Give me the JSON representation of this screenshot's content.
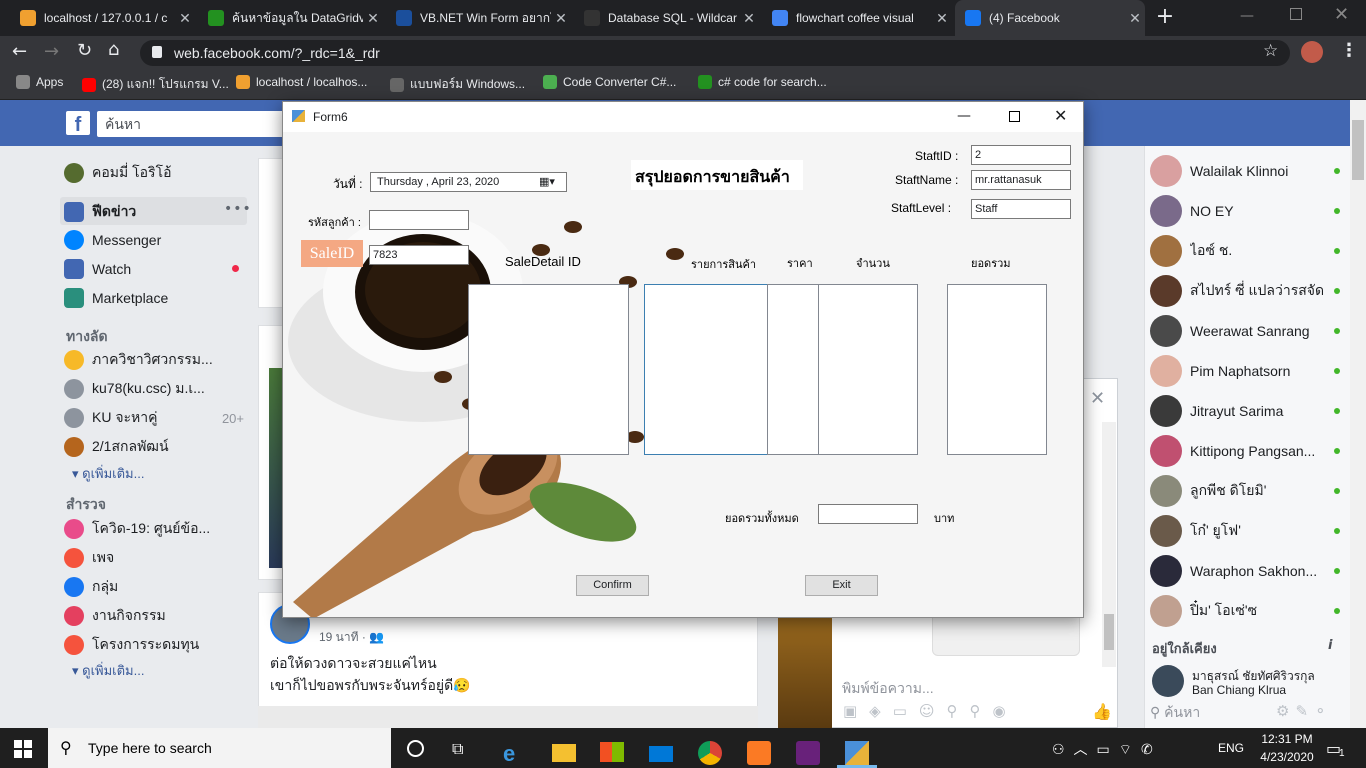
{
  "browser": {
    "tabs": [
      {
        "title": "localhost / 127.0.0.1 / c",
        "color": "#f0a030"
      },
      {
        "title": "ค้นหาข้อมูลใน DataGridvi",
        "color": "#239120"
      },
      {
        "title": "VB.NET Win Form อยากใ",
        "color": "#1b4f9c"
      },
      {
        "title": "Database SQL - Wildcar",
        "color": "#333333"
      },
      {
        "title": "flowchart coffee visual",
        "color": "#4285f4"
      },
      {
        "title": "(4) Facebook",
        "color": "#1877f2"
      }
    ],
    "url": "web.facebook.com/?_rdc=1&_rdr",
    "bookmarks": [
      {
        "label": "Apps",
        "color": "#888888"
      },
      {
        "label": "(28) แจก!! โปรแกรม V...",
        "color": "#ff0000"
      },
      {
        "label": "localhost / localhos...",
        "color": "#f0a030"
      },
      {
        "label": "แบบฟอร์ม Windows...",
        "color": "#666666"
      },
      {
        "label": "Code Converter C#...",
        "color": "#4caf50"
      },
      {
        "label": "c# code for search...",
        "color": "#239120"
      }
    ]
  },
  "facebook": {
    "search_placeholder": "ค้นหา",
    "profile_name": "คอมมี่ โอริโอ้",
    "nav": [
      {
        "label": "ฟีดข่าว",
        "color": "#4267b2"
      },
      {
        "label": "Messenger",
        "color": "#0084ff"
      },
      {
        "label": "Watch",
        "color": "#4267b2"
      },
      {
        "label": "Marketplace",
        "color": "#2a8f7d"
      }
    ],
    "shortcuts_title": "ทางลัด",
    "shortcuts": [
      {
        "label": "ภาควิชาวิศวกรรม...",
        "count": ""
      },
      {
        "label": "ku78(ku.csc) ม.เ...",
        "count": ""
      },
      {
        "label": "KU จะหาคู่",
        "count": "20+"
      },
      {
        "label": "2/1สกลพัฒน์",
        "count": ""
      }
    ],
    "see_more": "ดูเพิ่มเติม...",
    "explore_title": "สำรวจ",
    "explore": [
      {
        "label": "โควิด-19: ศูนย์ข้อ...",
        "color": "#e94b8a"
      },
      {
        "label": "เพจ",
        "color": "#f5533d"
      },
      {
        "label": "กลุ่ม",
        "color": "#1877f2"
      },
      {
        "label": "งานกิจกรรม",
        "color": "#e4405f"
      },
      {
        "label": "โครงการระดมทุน",
        "color": "#f5533d"
      }
    ],
    "post": {
      "time": "19 นาที",
      "line1": "ต่อให้ดวงดาวจะสวยแค่ไหน",
      "line2": "เขาก็ไปขอพรกับพระจันทร์อยู่ดี😥"
    },
    "contacts": [
      "Walailak Klinnoi",
      "NO EY",
      "ไอซ์ ช.",
      "สไปทร์ ซี่ แปลว่ารสจัด",
      "Weerawat Sanrang",
      "Pim Naphatsorn",
      "Jitrayut Sarima",
      "Kittipong Pangsan...",
      "ลูกพีช ดิโยมิ'",
      "โก๋' ยูโฟ'",
      "Waraphon Sakhon...",
      "ปิ๋ม' โอเซ่'ซ"
    ],
    "nearby_title": "อยู่ใกล้เคียง",
    "nearby": {
      "name": "มาธุสรณ์ ชัยทัศศิริวรกุล",
      "place": "Ban Chiang Klrua"
    },
    "contact_search": "ค้นหา",
    "chat_placeholder": "พิมพ์ข้อความ..."
  },
  "form": {
    "title": "Form6",
    "heading": "สรุปยอดการขายสินค้า",
    "date_label": "วันที่ :",
    "date_value": "Thursday  ,      April      23, 2020",
    "customer_label": "รหัสลูกค้า :",
    "customer_value": "",
    "saleid_label": "SaleID",
    "saleid_value": "7823",
    "staffid_label": "StaftID :",
    "staffid_value": "2",
    "staffname_label": "StaftName :",
    "staffname_value": "mr.rattanasuk",
    "stafflevel_label": "StaftLevel :",
    "stafflevel_value": "Staff",
    "col_saledetail": "SaleDetail ID",
    "col_product": "รายการสินค้า",
    "col_price": "ราคา",
    "col_qty": "จำนวน",
    "col_total": "ยอดรวม",
    "grand_total_label": "ยอดรวมทั้งหมด",
    "grand_total_value": "",
    "currency": "บาท",
    "confirm": "Confirm",
    "exit": "Exit"
  },
  "taskbar": {
    "search_placeholder": "Type here to search",
    "lang": "ENG",
    "time": "12:31 PM",
    "date": "4/23/2020",
    "notifications": "1"
  }
}
